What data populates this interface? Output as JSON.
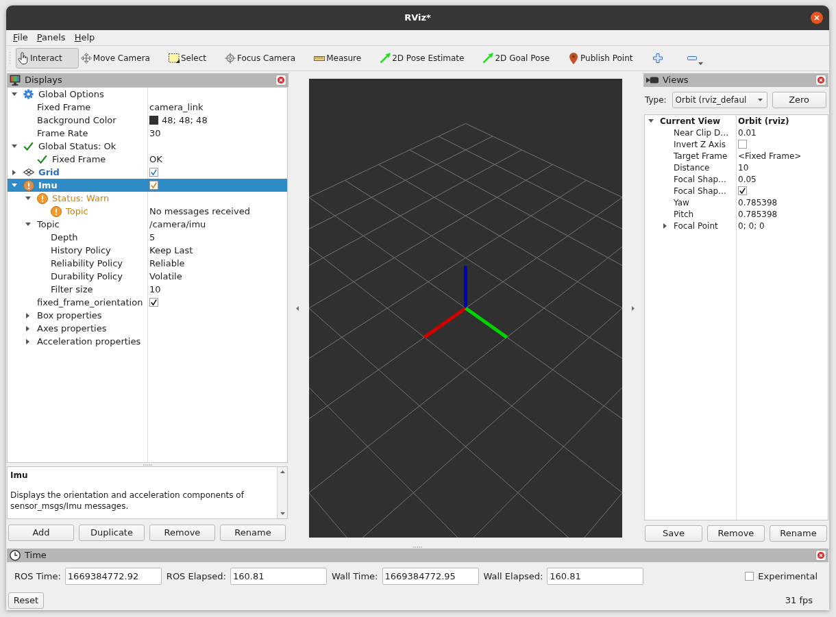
{
  "window": {
    "title": "RViz*"
  },
  "menu_bar": [
    {
      "label": "File"
    },
    {
      "label": "Panels"
    },
    {
      "label": "Help"
    }
  ],
  "toolbar": {
    "tools": [
      {
        "label": "Interact",
        "kind": "interact",
        "selected": true
      },
      {
        "label": "Move Camera",
        "kind": "move",
        "selected": false
      },
      {
        "label": "Select",
        "kind": "select",
        "selected": false
      },
      {
        "label": "Focus Camera",
        "kind": "focus",
        "selected": false
      },
      {
        "label": "Measure",
        "kind": "measure",
        "selected": false
      },
      {
        "label": "2D Pose Estimate",
        "kind": "pose",
        "selected": false
      },
      {
        "label": "2D Goal Pose",
        "kind": "goal",
        "selected": false
      },
      {
        "label": "Publish Point",
        "kind": "point",
        "selected": false
      }
    ]
  },
  "displays_panel": {
    "title": "Displays",
    "tree": [
      {
        "label": "Global Options",
        "kind": "options",
        "expanded": true,
        "selected": false,
        "children": [
          {
            "label": "Fixed Frame",
            "value": "camera_link"
          },
          {
            "label": "Background Color",
            "value": "48; 48; 48",
            "color": "#303030"
          },
          {
            "label": "Frame Rate",
            "value": "30"
          }
        ]
      },
      {
        "label": "Global Status: Ok",
        "kind": "status",
        "warning": false,
        "expanded": true,
        "selected": false,
        "children": [
          {
            "label": "Fixed Frame",
            "kind": "status",
            "warning": false,
            "value": "OK"
          }
        ]
      },
      {
        "label": "Grid",
        "kind": "display",
        "warning": false,
        "expanded": false,
        "checked": true,
        "selected": false
      },
      {
        "label": "Imu",
        "kind": "display",
        "warning": true,
        "expanded": true,
        "checked": true,
        "selected": true,
        "children": [
          {
            "label": "Status: Warn",
            "kind": "status",
            "warning": true,
            "expanded": true,
            "children": [
              {
                "label": "Topic",
                "kind": "status",
                "warning": true,
                "value": "No messages received"
              }
            ]
          },
          {
            "label": "Topic",
            "value": "/camera/imu",
            "expanded": true,
            "children": [
              {
                "label": "Depth",
                "value": "5"
              },
              {
                "label": "History Policy",
                "value": "Keep Last"
              },
              {
                "label": "Reliability Policy",
                "value": "Reliable"
              },
              {
                "label": "Durability Policy",
                "value": "Volatile"
              },
              {
                "label": "Filter size",
                "value": "10"
              }
            ]
          },
          {
            "label": "fixed_frame_orientation",
            "checked": true
          },
          {
            "label": "Box properties",
            "expanded": false
          },
          {
            "label": "Axes properties",
            "expanded": false
          },
          {
            "label": "Acceleration properties",
            "expanded": false
          }
        ]
      }
    ],
    "description": {
      "title": "Imu",
      "text": "Displays the orientation and acceleration components of sensor_msgs/Imu messages."
    },
    "buttons": [
      {
        "label": "Add"
      },
      {
        "label": "Duplicate"
      },
      {
        "label": "Remove"
      },
      {
        "label": "Rename"
      }
    ]
  },
  "views_panel": {
    "title": "Views",
    "type": {
      "label": "Type:",
      "value": "Orbit (rviz_defaul"
    },
    "zero_button": "Zero",
    "tree": [
      {
        "label": "Current View",
        "value": "Orbit (rviz)",
        "expanded": true,
        "children": [
          {
            "label": "Near Clip D…",
            "value": "0.01"
          },
          {
            "label": "Invert Z Axis",
            "checked": false
          },
          {
            "label": "Target Frame",
            "value": "<Fixed Frame>"
          },
          {
            "label": "Distance",
            "value": "10"
          },
          {
            "label": "Focal Shap…",
            "value": "0.05"
          },
          {
            "label": "Focal Shap…",
            "checked": true
          },
          {
            "label": "Yaw",
            "value": "0.785398"
          },
          {
            "label": "Pitch",
            "value": "0.785398"
          },
          {
            "label": "Focal Point",
            "value": "0; 0; 0",
            "expanded": false
          }
        ]
      }
    ],
    "buttons": [
      {
        "label": "Save"
      },
      {
        "label": "Remove"
      },
      {
        "label": "Rename"
      }
    ]
  },
  "time_panel": {
    "title": "Time",
    "fields": [
      {
        "label": "ROS Time:",
        "value": "1669384772.92"
      },
      {
        "label": "ROS Elapsed:",
        "value": "160.81"
      },
      {
        "label": "Wall Time:",
        "value": "1669384772.95"
      },
      {
        "label": "Wall Elapsed:",
        "value": "160.81"
      }
    ],
    "experimental": {
      "label": "Experimental",
      "checked": false
    },
    "reset_button": "Reset",
    "fps": "31 fps"
  }
}
